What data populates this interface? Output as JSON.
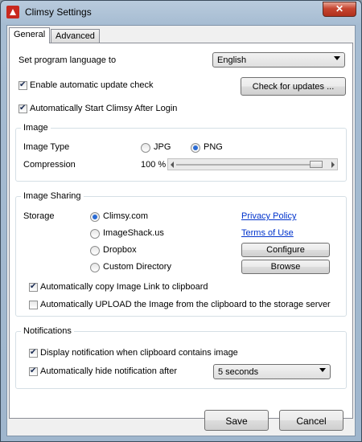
{
  "window": {
    "title": "Climsy Settings",
    "close_glyph": "✕"
  },
  "tabs": [
    {
      "label": "General",
      "active": true
    },
    {
      "label": "Advanced",
      "active": false
    }
  ],
  "general": {
    "language_label": "Set program language to",
    "language_value": "English",
    "auto_update_label": "Enable automatic update check",
    "auto_update_checked": true,
    "check_updates_button": "Check for updates ...",
    "autostart_label": "Automatically Start Climsy After Login",
    "autostart_checked": true
  },
  "image": {
    "group_title": "Image",
    "type_label": "Image Type",
    "jpg_label": "JPG",
    "png_label": "PNG",
    "selected_type": "PNG",
    "compression_label": "Compression",
    "compression_value": "100 %",
    "compression_level": 1.0
  },
  "sharing": {
    "group_title": "Image Sharing",
    "storage_label": "Storage",
    "options": [
      {
        "label": "Climsy.com",
        "selected": true
      },
      {
        "label": "ImageShack.us",
        "selected": false
      },
      {
        "label": "Dropbox",
        "selected": false
      },
      {
        "label": "Custom Directory",
        "selected": false
      }
    ],
    "privacy_link": "Privacy Policy",
    "terms_link": "Terms of Use",
    "configure_button": "Configure",
    "browse_button": "Browse",
    "auto_copy_label": "Automatically copy Image Link to clipboard",
    "auto_copy_checked": true,
    "auto_upload_label": "Automatically UPLOAD the Image from the clipboard to the storage server",
    "auto_upload_checked": false
  },
  "notifications": {
    "group_title": "Notifications",
    "display_label": "Display notification when clipboard contains image",
    "display_checked": true,
    "autohide_label": "Automatically hide notification after",
    "autohide_checked": true,
    "autohide_value": "5 seconds"
  },
  "footer": {
    "save_button": "Save",
    "cancel_button": "Cancel"
  }
}
